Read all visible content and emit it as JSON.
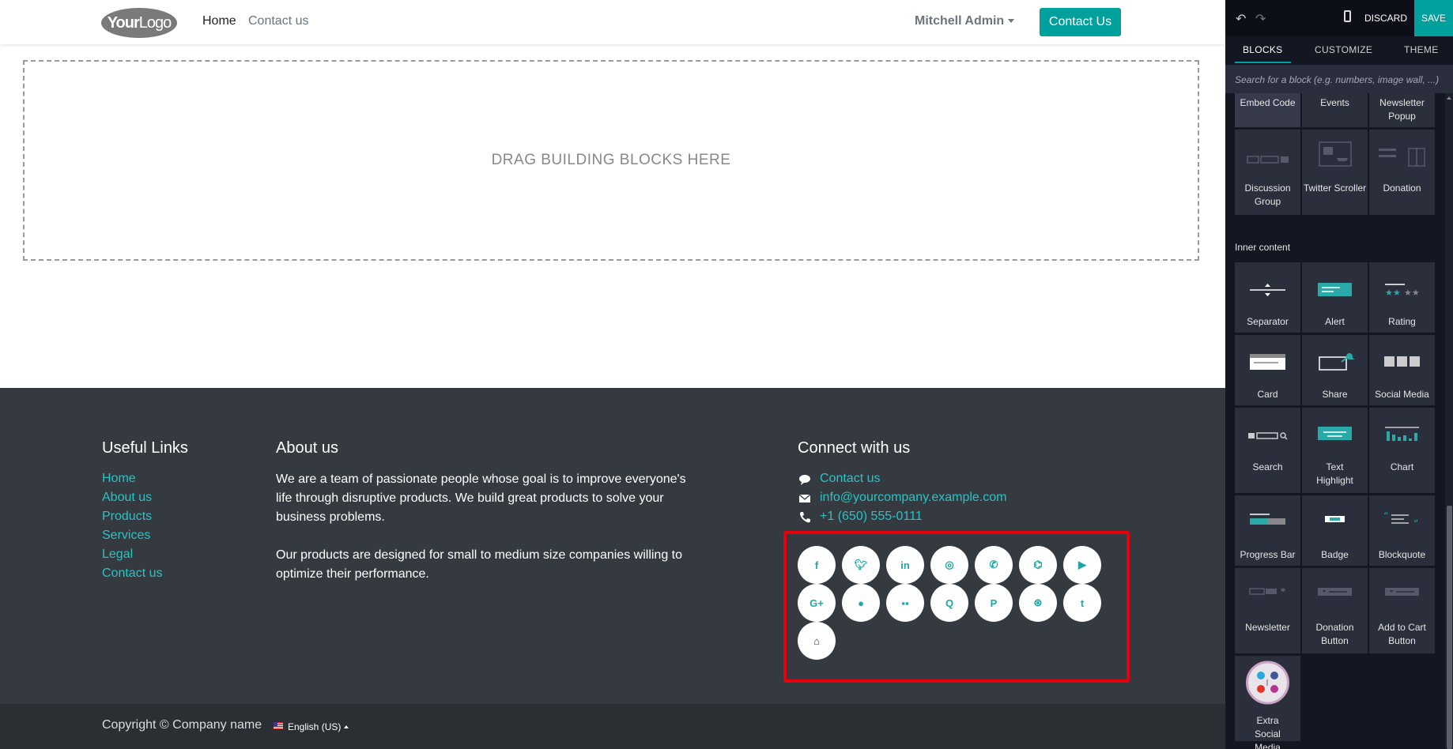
{
  "site": {
    "logo": {
      "bold": "Your",
      "rest": "Logo"
    },
    "nav": {
      "home": "Home",
      "contact": "Contact us"
    },
    "user": "Mitchell Admin",
    "cta": "Contact Us",
    "dropzone": "DRAG BUILDING BLOCKS HERE"
  },
  "footer": {
    "useful_links": {
      "title": "Useful Links",
      "items": [
        "Home",
        "About us",
        "Products",
        "Services",
        "Legal",
        "Contact us"
      ]
    },
    "about": {
      "title": "About us",
      "p1": "We are a team of passionate people whose goal is to improve everyone's life through disruptive products. We build great products to solve your business problems.",
      "p2": "Our products are designed for small to medium size companies willing to optimize their performance."
    },
    "connect": {
      "title": "Connect with us",
      "contact": "Contact us",
      "email": "info@yourcompany.example.com",
      "phone": "+1 (650) 555-0111"
    },
    "social_icons": [
      "facebook-icon",
      "twitter-icon",
      "linkedin-icon",
      "instagram-icon",
      "whatsapp-icon",
      "github-icon",
      "youtube-icon",
      "google-plus-icon",
      "skype-icon",
      "flickr-icon",
      "quora-icon",
      "pinterest-icon",
      "dribbble-icon",
      "tumblr-icon",
      "home-icon"
    ],
    "copyright": "Copyright © Company name",
    "language": "English (US)"
  },
  "editor": {
    "discard": "DISCARD",
    "save": "SAVE",
    "tabs": [
      "BLOCKS",
      "CUSTOMIZE",
      "THEME"
    ],
    "search_placeholder": "Search for a block (e.g. numbers, image wall, ...)",
    "top_blocks": [
      "Embed Code",
      "Events",
      "Newsletter Popup",
      "Discussion Group",
      "Twitter Scroller",
      "Donation"
    ],
    "inner_content_title": "Inner content",
    "inner_blocks": [
      "Separator",
      "Alert",
      "Rating",
      "Card",
      "Share",
      "Social Media",
      "Search",
      "Text Highlight",
      "Chart",
      "Progress Bar",
      "Badge",
      "Blockquote",
      "Newsletter",
      "Donation Button",
      "Add to Cart Button",
      "Extra Social Media"
    ]
  },
  "colors": {
    "accent": "#00a09d",
    "link": "#2bc2c4",
    "footer_bg": "#343a40",
    "highlight": "#e8000b"
  }
}
